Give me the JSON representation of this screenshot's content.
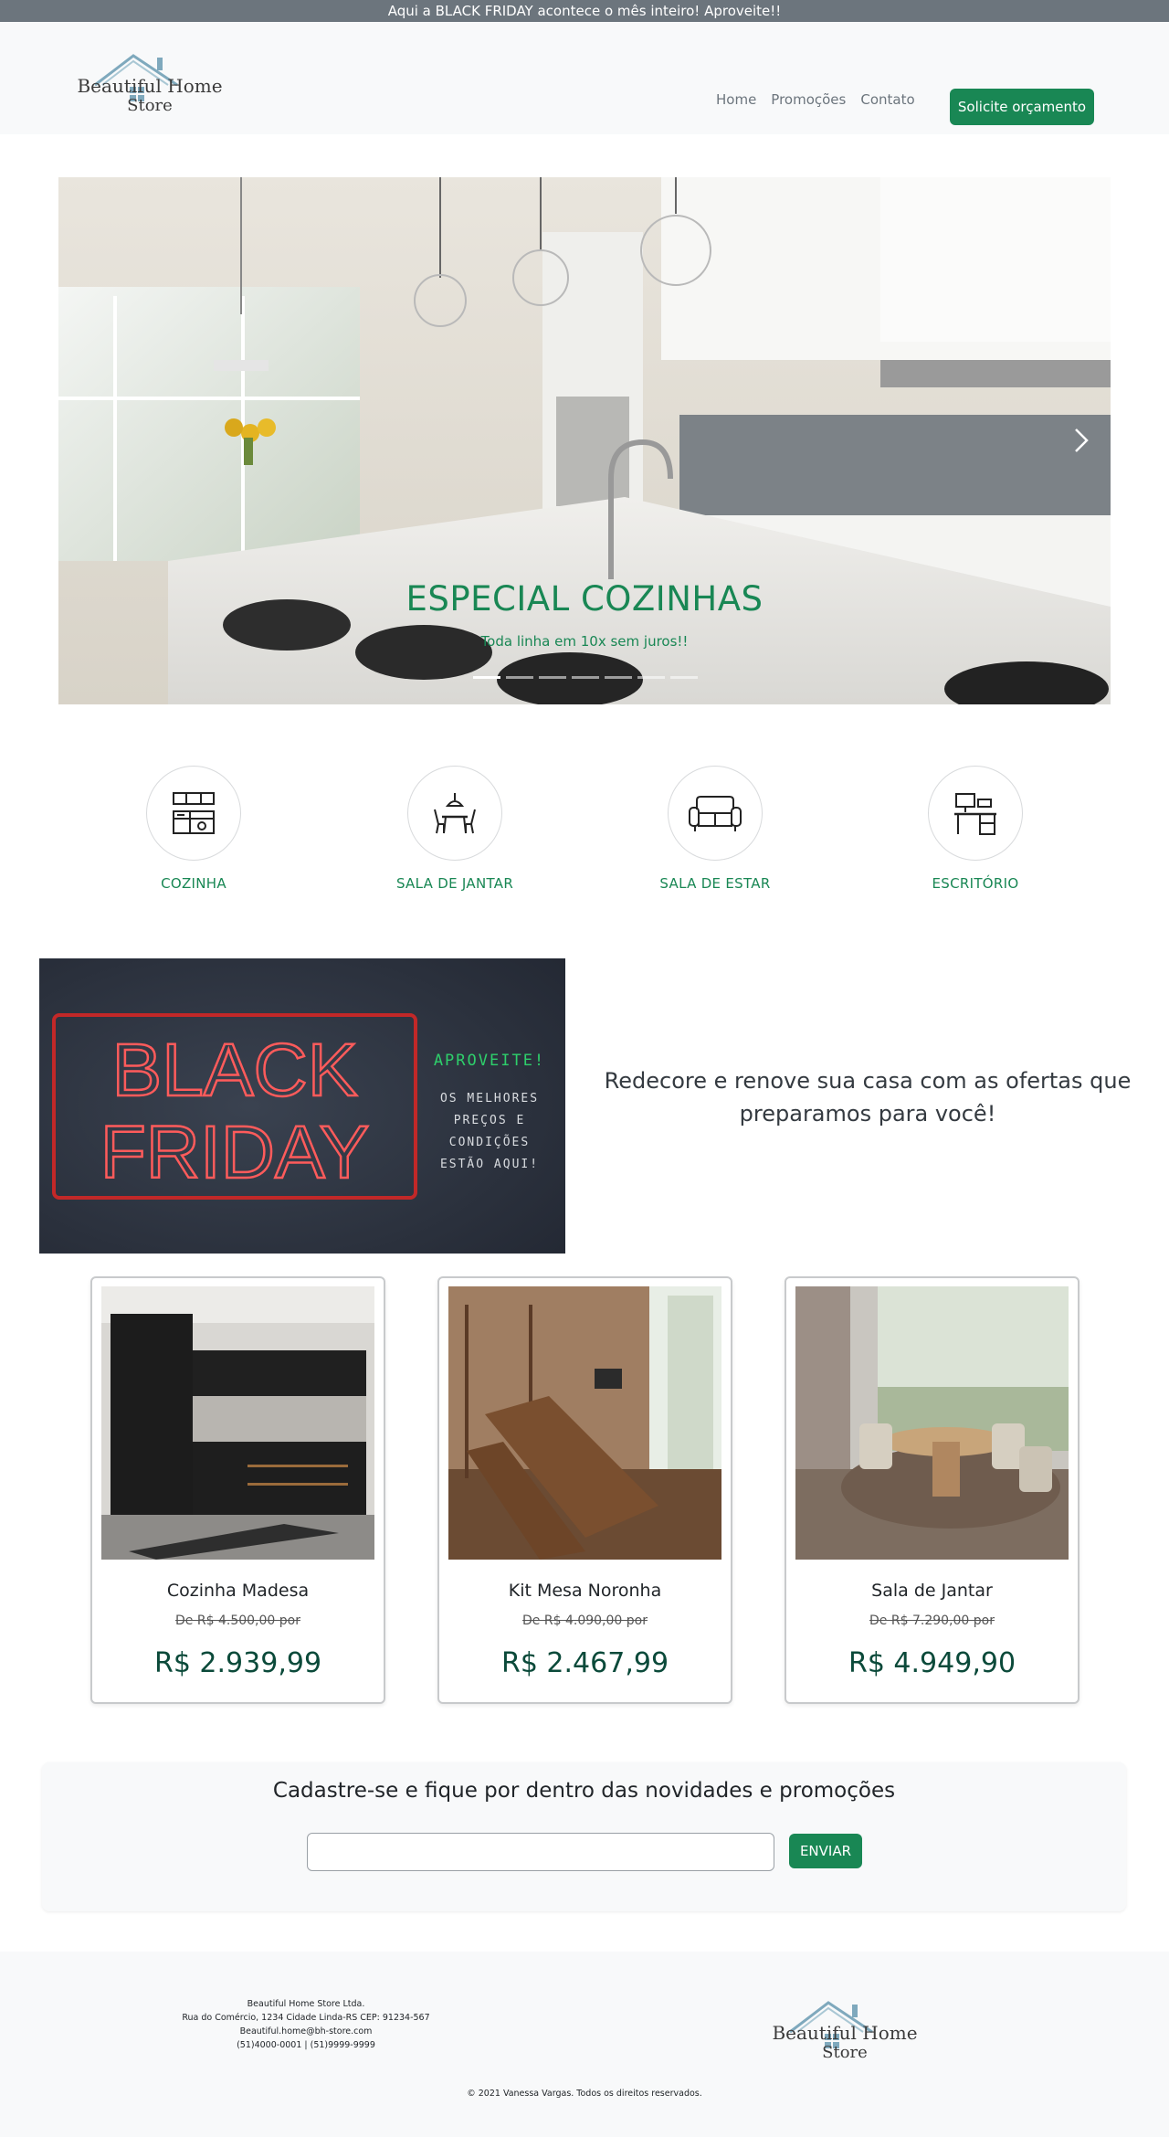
{
  "announcement": "Aqui a BLACK FRIDAY acontece o mês inteiro! Aproveite!!",
  "brand": {
    "logo_word1": "Beautiful Home",
    "logo_word2": "Store",
    "accent": "#198754"
  },
  "nav": {
    "links": [
      "Home",
      "Promoções",
      "Contato"
    ],
    "cta": "Solicite orçamento"
  },
  "carousel": {
    "title": "ESPECIAL COZINHAS",
    "subtitle": "Toda linha em 10x sem juros!!",
    "next_icon": "chevron-right-icon",
    "slides_count": 7,
    "active_index": 0
  },
  "categories": [
    {
      "label": "COZINHA",
      "icon": "kitchen-icon"
    },
    {
      "label": "SALA DE JANTAR",
      "icon": "dining-table-icon"
    },
    {
      "label": "SALA DE ESTAR",
      "icon": "sofa-icon"
    },
    {
      "label": "ESCRITÓRIO",
      "icon": "office-desk-icon"
    }
  ],
  "promo": {
    "banner_big": [
      "BLACK",
      "FRIDAY"
    ],
    "banner_aproveite": "APROVEITE!",
    "banner_lines": [
      "OS MELHORES",
      "PREÇOS E",
      "CONDIÇÕES",
      "ESTÃO AQUI!"
    ],
    "text": "Redecore e renove sua casa com as ofertas que preparamos para você!"
  },
  "products": [
    {
      "name": "Cozinha Madesa",
      "old_price": "De R$ 4.500,00 por",
      "price": "R$ 2.939,99"
    },
    {
      "name": "Kit Mesa Noronha",
      "old_price": "De R$ 4.090,00 por",
      "price": "R$ 2.467,99"
    },
    {
      "name": "Sala de Jantar",
      "old_price": "De R$ 7.290,00 por",
      "price": "R$ 4.949,90"
    }
  ],
  "newsletter": {
    "title": "Cadastre-se e fique por dentro das novidades e promoções",
    "input_value": "",
    "button": "ENVIAR"
  },
  "footer": {
    "company": "Beautiful Home Store Ltda.",
    "address": "Rua do Comércio, 1234 Cidade Linda-RS CEP: 91234-567",
    "email": "Beautiful.home@bh-store.com",
    "phones": "(51)4000-0001 | (51)9999-9999",
    "copyright": "© 2021 Vanessa Vargas. Todos os direitos reservados."
  }
}
